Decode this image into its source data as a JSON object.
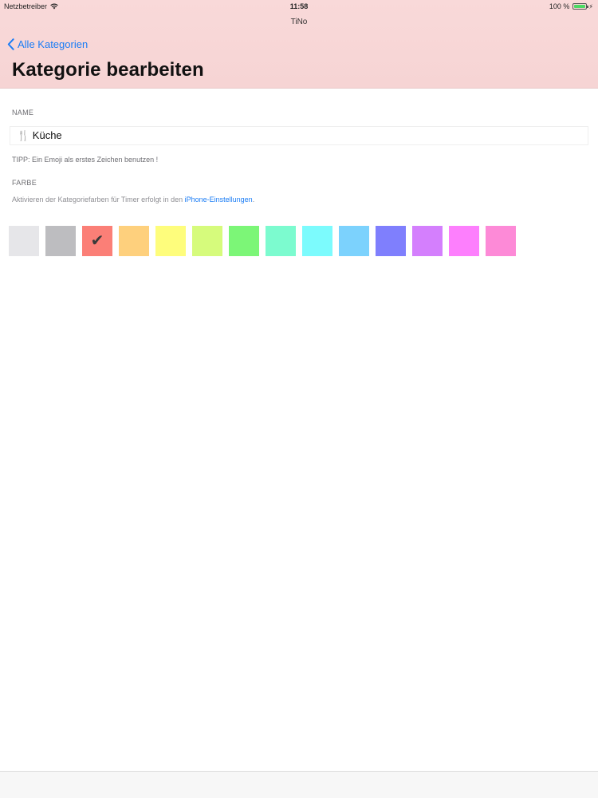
{
  "status_bar": {
    "carrier": "Netzbetreiber",
    "time": "11:58",
    "battery": "100 %"
  },
  "app_name": "TiNo",
  "nav": {
    "back_label": "Alle Kategorien",
    "title": "Kategorie bearbeiten"
  },
  "name_section": {
    "label": "NAME",
    "value": "🍴 Küche",
    "tip": "TIPP: Ein Emoji als erstes Zeichen benutzen !"
  },
  "color_section": {
    "label": "FARBE",
    "info_prefix": "Aktivieren der Kategoriefarben für Timer erfolgt in den ",
    "info_link": "iPhone-Einstellungen",
    "info_suffix": ".",
    "selected_index": 2,
    "swatches": [
      "#e6e6e9",
      "#bdbdc0",
      "#fb7f77",
      "#fed07d",
      "#fefd7c",
      "#d6fb7c",
      "#7cf677",
      "#7cfbcf",
      "#7cfbfd",
      "#7cd2fd",
      "#7f7ffd",
      "#d47ffd",
      "#fd7ffd",
      "#fd8ad7"
    ]
  },
  "colors": {
    "header_bg": "#f8d7d7",
    "accent": "#1a7cf5"
  }
}
